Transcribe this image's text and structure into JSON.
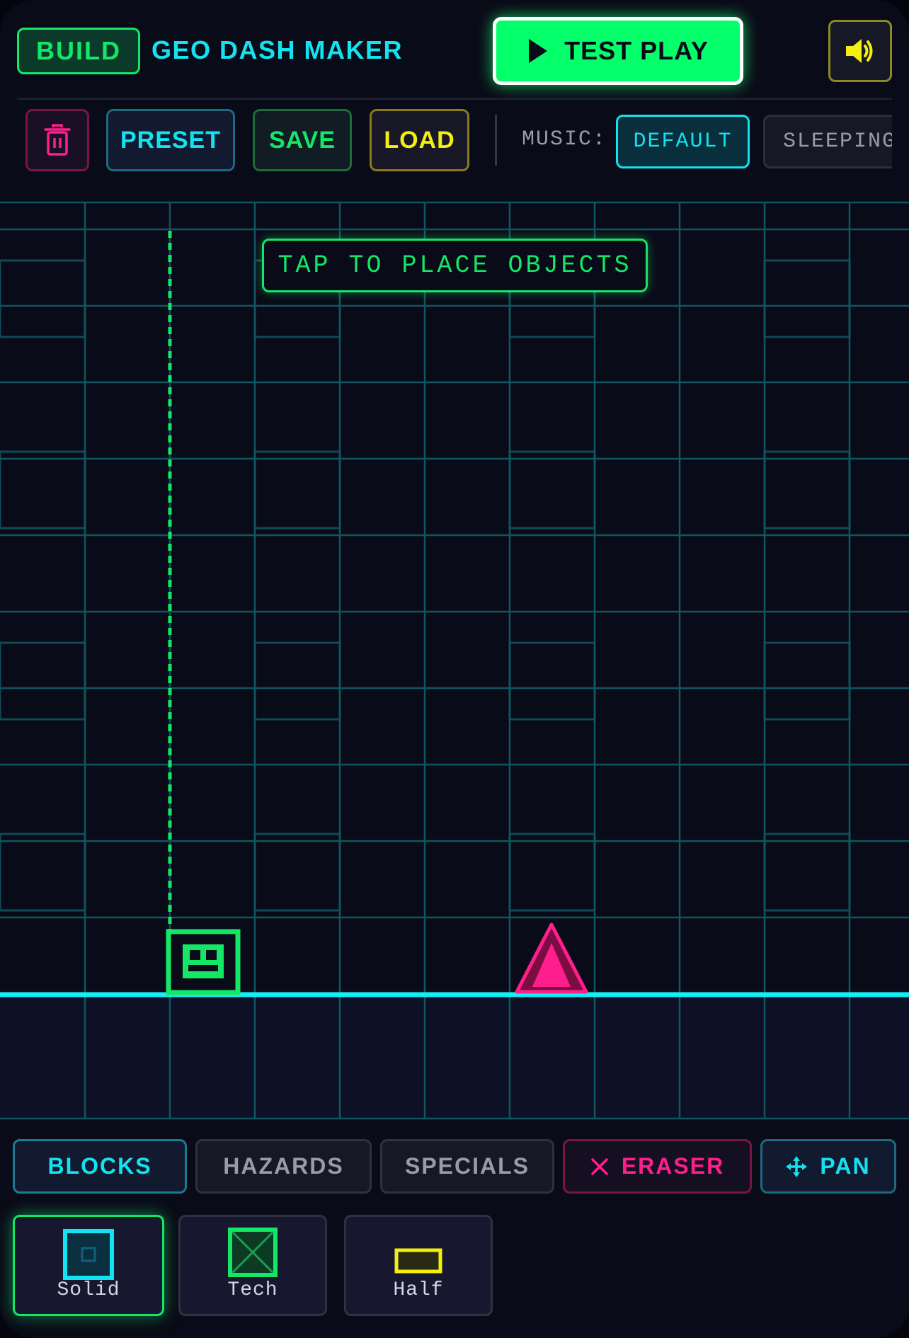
{
  "header": {
    "mode_badge": "BUILD",
    "title": "GEO DASH MAKER",
    "test_play_label": "TEST PLAY",
    "sound_icon": "speaker-volume-icon"
  },
  "toolbar": {
    "trash_icon": "trash-icon",
    "preset_label": "PRESET",
    "save_label": "SAVE",
    "load_label": "LOAD",
    "music_label": "MUSIC:",
    "music_tracks": [
      "DEFAULT",
      "SLEEPING"
    ],
    "selected_track": "DEFAULT"
  },
  "editor": {
    "hint": "TAP TO PLACE OBJECTS",
    "objects": [
      "player-cube",
      "spike-hazard"
    ]
  },
  "categories": {
    "tabs": [
      "BLOCKS",
      "HAZARDS",
      "SPECIALS",
      "ERASER",
      "PAN"
    ],
    "active": "BLOCKS"
  },
  "palette": {
    "items": [
      "Solid",
      "Tech",
      "Half"
    ],
    "selected": "Solid"
  },
  "colors": {
    "neon_green": "#14e665",
    "cyan": "#13e2f0",
    "magenta": "#ff1e8c",
    "yellow": "#f4ef10",
    "background": "#0a0b18"
  }
}
